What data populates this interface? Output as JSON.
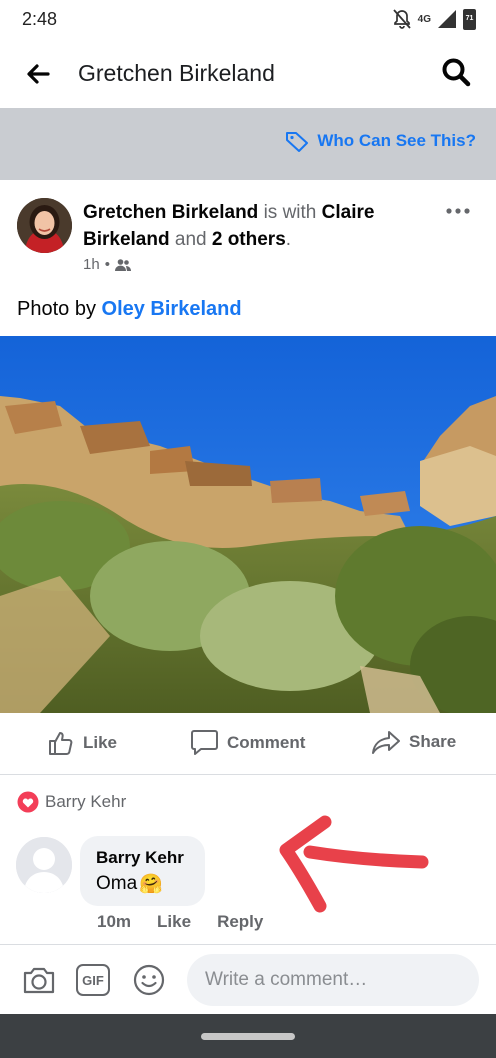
{
  "status_bar": {
    "time": "2:48",
    "network_label": "4G",
    "battery_level": "71"
  },
  "header": {
    "title": "Gretchen Birkeland"
  },
  "privacy": {
    "link_label": "Who Can See This?"
  },
  "post": {
    "author": "Gretchen Birkeland",
    "connector_with": "is with",
    "tagged_name": "Claire Birkeland",
    "connector_and": "and",
    "others_label": "2 others",
    "period": ".",
    "timestamp": "1h",
    "separator": "•",
    "photo_credit_prefix": "Photo by",
    "photo_credit_name": "Oley Birkeland"
  },
  "actions": {
    "like": "Like",
    "comment": "Comment",
    "share": "Share"
  },
  "reactions": {
    "reactor": "Barry Kehr"
  },
  "comment": {
    "author": "Barry Kehr",
    "text": "Oma",
    "emoji": "🤗",
    "age": "10m",
    "like": "Like",
    "reply": "Reply"
  },
  "composer": {
    "placeholder": "Write a comment…",
    "gif_label": "GIF"
  },
  "colors": {
    "accent": "#1877f2",
    "love_reaction": "#f33e58",
    "annotation": "#e8414a"
  }
}
